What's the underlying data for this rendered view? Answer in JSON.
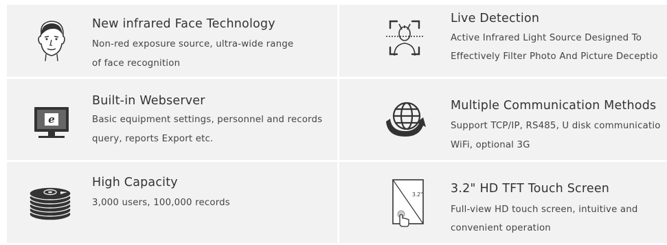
{
  "features": [
    {
      "id": "face",
      "icon": "face-portrait-icon",
      "title": "New infrared Face Technology",
      "lines": [
        "Non-red exposure source, ultra-wide range",
        "of face recognition"
      ]
    },
    {
      "id": "live",
      "icon": "face-scan-icon",
      "title": "Live Detection",
      "lines": [
        "Active Infrared Light Source Designed To",
        "Effectively Filter Photo And Picture Deceptio"
      ]
    },
    {
      "id": "web",
      "icon": "monitor-browser-icon",
      "title": "Built-in Webserver",
      "lines": [
        "Basic equipment settings, personnel and records",
        "query, reports Export etc."
      ]
    },
    {
      "id": "comm",
      "icon": "globe-arrow-icon",
      "title": "Multiple Communication Methods",
      "lines": [
        "Support TCP/IP, RS485, U disk communicatio",
        "WiFi, optional 3G"
      ]
    },
    {
      "id": "capacity",
      "icon": "disk-stack-icon",
      "title": "High Capacity",
      "lines": [
        "3,000 users, 100,000 records"
      ]
    },
    {
      "id": "screen",
      "icon": "touch-screen-icon",
      "title": "3.2\" HD TFT Touch Screen",
      "lines": [
        "Full-view HD touch screen, intuitive and",
        "convenient operation"
      ],
      "screen_label": "3.2\""
    }
  ]
}
